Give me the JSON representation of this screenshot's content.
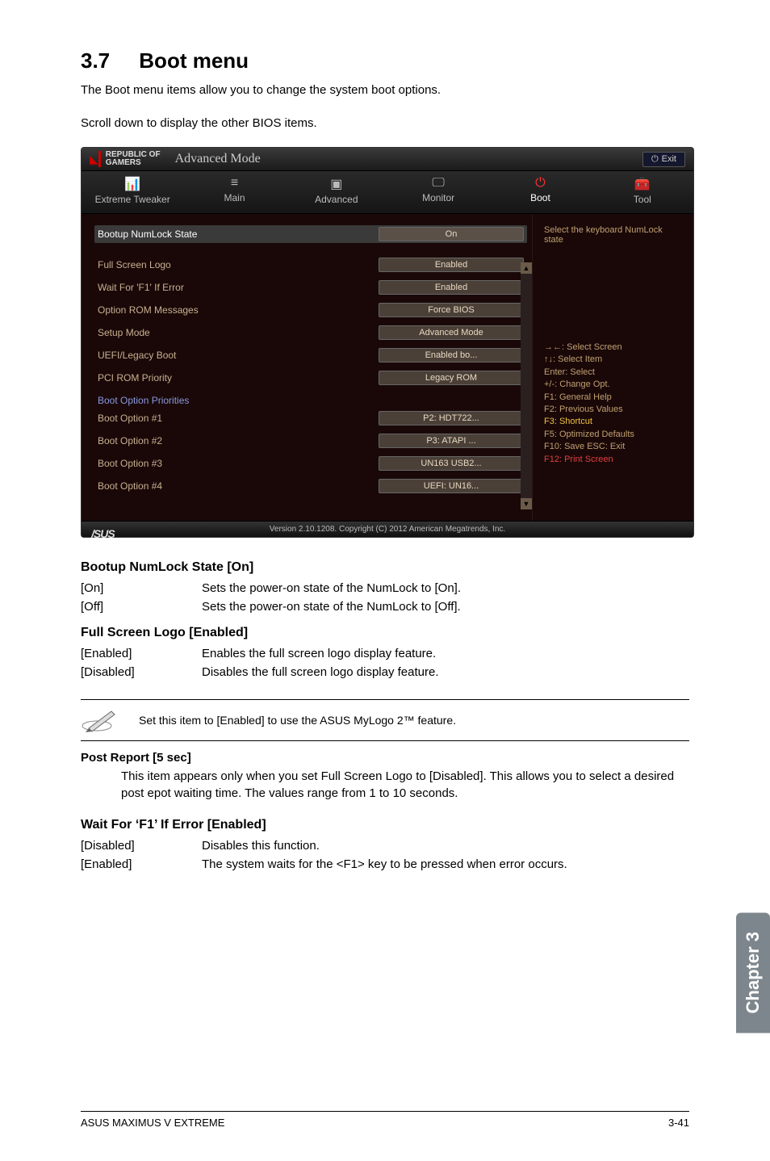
{
  "heading": {
    "num": "3.7",
    "title": "Boot menu"
  },
  "intro1": "The Boot menu items allow you to change the system boot options.",
  "intro2": "Scroll down to display the other BIOS items.",
  "bios": {
    "brand_line1": "REPUBLIC OF",
    "brand_line2": "GAMERS",
    "mode": "Advanced Mode",
    "exit": "Exit",
    "tabs": {
      "t0": "Extreme Tweaker",
      "t1": "Main",
      "t2": "Advanced",
      "t3": "Monitor",
      "t4": "Boot",
      "t5": "Tool"
    },
    "rows": {
      "r0": {
        "label": "Bootup NumLock State",
        "val": "On"
      },
      "r1": {
        "label": "Full Screen Logo",
        "val": "Enabled"
      },
      "r2": {
        "label": "Wait For 'F1' If Error",
        "val": "Enabled"
      },
      "r3": {
        "label": "Option ROM Messages",
        "val": "Force BIOS"
      },
      "r4": {
        "label": "Setup Mode",
        "val": "Advanced Mode"
      },
      "r5": {
        "label": "UEFI/Legacy Boot",
        "val": "Enabled bo..."
      },
      "r6": {
        "label": "PCI ROM Priority",
        "val": "Legacy ROM"
      }
    },
    "boot_section": "Boot Option Priorities",
    "boot_opts": {
      "b0": {
        "label": "Boot Option #1",
        "val": "P2: HDT722..."
      },
      "b1": {
        "label": "Boot Option #2",
        "val": "P3: ATAPI ..."
      },
      "b2": {
        "label": "Boot Option #3",
        "val": "UN163 USB2..."
      },
      "b3": {
        "label": "Boot Option #4",
        "val": "UEFI: UN16..."
      }
    },
    "help": "Select the keyboard NumLock state",
    "keys": {
      "k0": "→←: Select Screen",
      "k1": "↑↓: Select Item",
      "k2": "Enter: Select",
      "k3": "+/-: Change Opt.",
      "k4": "F1: General Help",
      "k5": "F2: Previous Values",
      "k6": "F3: Shortcut",
      "k7": "F5: Optimized Defaults",
      "k8": "F10: Save  ESC: Exit",
      "k9": "F12: Print Screen"
    },
    "footer": "Version 2.10.1208. Copyright (C) 2012 American Megatrends, Inc.",
    "logo": "/SUS"
  },
  "doc": {
    "numlock": {
      "head": "Bootup NumLock State [On]",
      "on_k": "[On]",
      "on_v": "Sets the power-on state of the NumLock to [On].",
      "off_k": "[Off]",
      "off_v": "Sets the power-on state of the NumLock to [Off]."
    },
    "fslogo": {
      "head": "Full Screen Logo [Enabled]",
      "en_k": "[Enabled]",
      "en_v": "Enables the full screen logo display feature.",
      "dis_k": "[Disabled]",
      "dis_v": "Disables the full screen logo display feature."
    },
    "note": "Set this item to [Enabled] to use the ASUS MyLogo 2™ feature.",
    "post": {
      "head": "Post Report [5 sec]",
      "body": "This item appears only when you set Full Screen Logo to [Disabled]. This allows you to select a desired post epot waiting time. The values range from 1 to 10 seconds."
    },
    "waitf1": {
      "head": "Wait For ‘F1’ If Error [Enabled]",
      "dis_k": "[Disabled]",
      "dis_v": "Disables this function.",
      "en_k": "[Enabled]",
      "en_v": "The system waits for the <F1> key to be pressed when error occurs."
    }
  },
  "sidetab": "Chapter 3",
  "footer": {
    "left": "ASUS MAXIMUS V EXTREME",
    "right": "3-41"
  }
}
